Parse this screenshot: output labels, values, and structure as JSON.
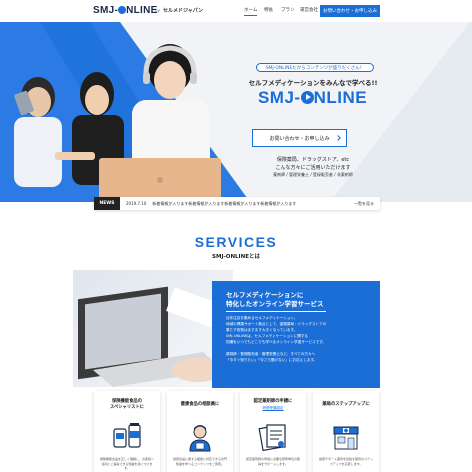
{
  "header": {
    "logo": "SMJ-ONLINE",
    "logo_by": "by",
    "logo_company": "セルメドジャパン",
    "nav": [
      "ホーム",
      "特長",
      "プラン",
      "運営会社"
    ],
    "cta": "お問い合わせ・お申し込み"
  },
  "hero": {
    "bubble": "SMJ-ONLINEだからコンテンツが盛りだくさん！",
    "subtitle": "セルフメディケーションをみんなで学べる!!",
    "logo": "SMJ-ONLINE",
    "button": "お問い合わせ・お申し込み",
    "text_lines": [
      "保険薬局、ドラッグストア、etc",
      "こんな方々にご活用いただけます"
    ],
    "roles": "薬剤師 / 管理栄養士 / 登録販売者 / 非薬剤師"
  },
  "news": {
    "label": "NEWS",
    "date": "2019.7.10",
    "text": "新着情報が入ります新着情報が入ります新着情報が入ります新着情報が入ります",
    "more": "一覧を見る"
  },
  "services": {
    "title": "SERVICES",
    "subtitle": "SMJ-ONLINEとは",
    "box_title_lines": [
      "セルフメディケーションに",
      "特化したオンライン学習サービス"
    ],
    "box_body_lines": [
      "近年注目を集めるセルフメディケーション。",
      "地域の健康サポート拠点として、保険薬局・ドラッグストアの",
      "果たす役割はますます大きくなっています。",
      "SMJ-ONLINEは、セルフメディケーションに関する",
      "知識をいつでもどこでも学べるオンライン学習サービスです。",
      "",
      "薬剤師・登録販売者・管理栄養士など、すべての方々へ",
      "「今すぐ知りたい」「今さら聞けない」にお応えします。"
    ]
  },
  "cards": [
    {
      "title_lines": [
        "保険機能食品の",
        "スペシャリストに"
      ],
      "icon": "supplement-icon",
      "text": "保険機能食品を正しく理解し、お客様へ適切にご提案できる知識を身につけます。"
    },
    {
      "title_lines": [
        "健康食品の相談員に"
      ],
      "icon": "consultant-icon",
      "text": "健康食品に関する相談に対応できる専門知識を学べるコンテンツをご用意。"
    },
    {
      "title_lines": [
        "認定薬剤師の申請に"
      ],
      "icon": "certificate-icon",
      "badge": "研修受講認定",
      "text": "認定薬剤師の申請に必要な研修単位の取得をサポートします。"
    },
    {
      "title_lines": [
        "薬局のステップアップに"
      ],
      "icon": "pharmacy-icon",
      "text": "健康サポート薬局を目指す薬局のステップアップを応援します。"
    }
  ],
  "colors": {
    "accent": "#1b6ed6",
    "dark": "#222222"
  }
}
